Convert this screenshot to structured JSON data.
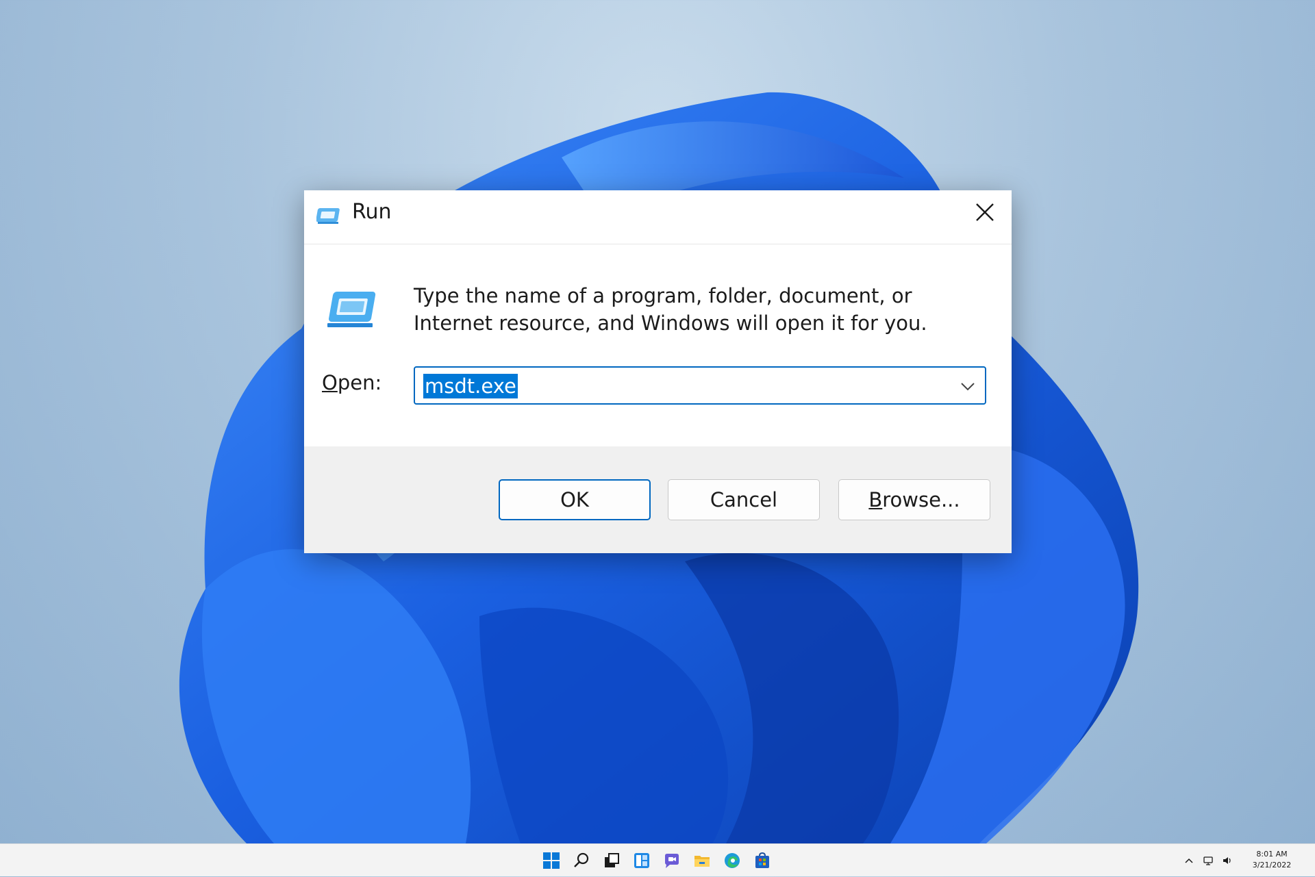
{
  "dialog": {
    "title": "Run",
    "description": "Type the name of a program, folder, document, or Internet resource, and Windows will open it for you.",
    "open_label_accel": "O",
    "open_label_rest": "pen:",
    "open_value": "msdt.exe",
    "buttons": {
      "ok": "OK",
      "cancel": "Cancel",
      "browse_accel": "B",
      "browse_rest": "rowse..."
    }
  },
  "taskbar": {
    "icons": [
      "start-icon",
      "search-icon",
      "task-view-icon",
      "widgets-icon",
      "chat-icon",
      "file-explorer-icon",
      "edge-icon",
      "store-icon"
    ],
    "tray_icons": [
      "chevron-up-icon",
      "network-icon",
      "volume-icon"
    ],
    "time": "8:01 AM",
    "date": "3/21/2022"
  },
  "colors": {
    "accent": "#0067c0",
    "selection": "#0078d7",
    "wallpaper_bloom": "#1a5fe0"
  }
}
